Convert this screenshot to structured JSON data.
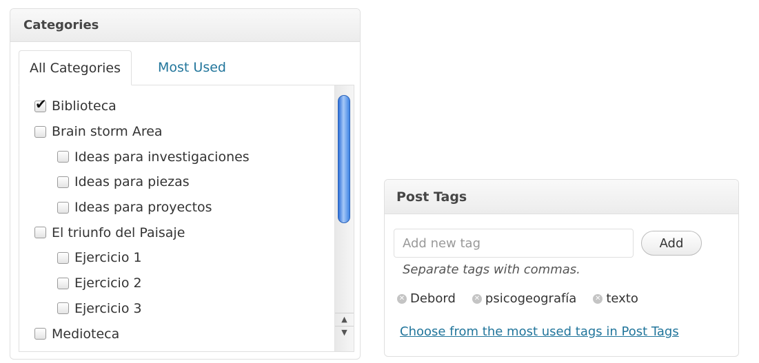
{
  "categories_box": {
    "title": "Categories",
    "tabs": [
      {
        "label": "All Categories",
        "active": true
      },
      {
        "label": "Most Used",
        "active": false
      }
    ],
    "items": [
      {
        "label": "Biblioteca",
        "checked": true,
        "level": 0
      },
      {
        "label": "Brain storm Area",
        "checked": false,
        "level": 0
      },
      {
        "label": "Ideas para investigaciones",
        "checked": false,
        "level": 1
      },
      {
        "label": "Ideas para piezas",
        "checked": false,
        "level": 1
      },
      {
        "label": "Ideas para proyectos",
        "checked": false,
        "level": 1
      },
      {
        "label": "El triunfo del Paisaje",
        "checked": false,
        "level": 0
      },
      {
        "label": "Ejercicio 1",
        "checked": false,
        "level": 1
      },
      {
        "label": "Ejercicio 2",
        "checked": false,
        "level": 1
      },
      {
        "label": "Ejercicio 3",
        "checked": false,
        "level": 1
      },
      {
        "label": "Medioteca",
        "checked": false,
        "level": 0
      }
    ],
    "check_glyph": "✔",
    "scroll_up_glyph": "▲",
    "scroll_down_glyph": "▼"
  },
  "post_tags_box": {
    "title": "Post Tags",
    "input_placeholder": "Add new tag",
    "add_label": "Add",
    "hint": "Separate tags with commas.",
    "tags": [
      "Debord",
      "psicogeografía",
      "texto"
    ],
    "remove_glyph": "✕",
    "most_used_link": "Choose from the most used tags in Post Tags"
  },
  "colors": {
    "link": "#21759b",
    "scroll_thumb": "#3f84e4"
  }
}
